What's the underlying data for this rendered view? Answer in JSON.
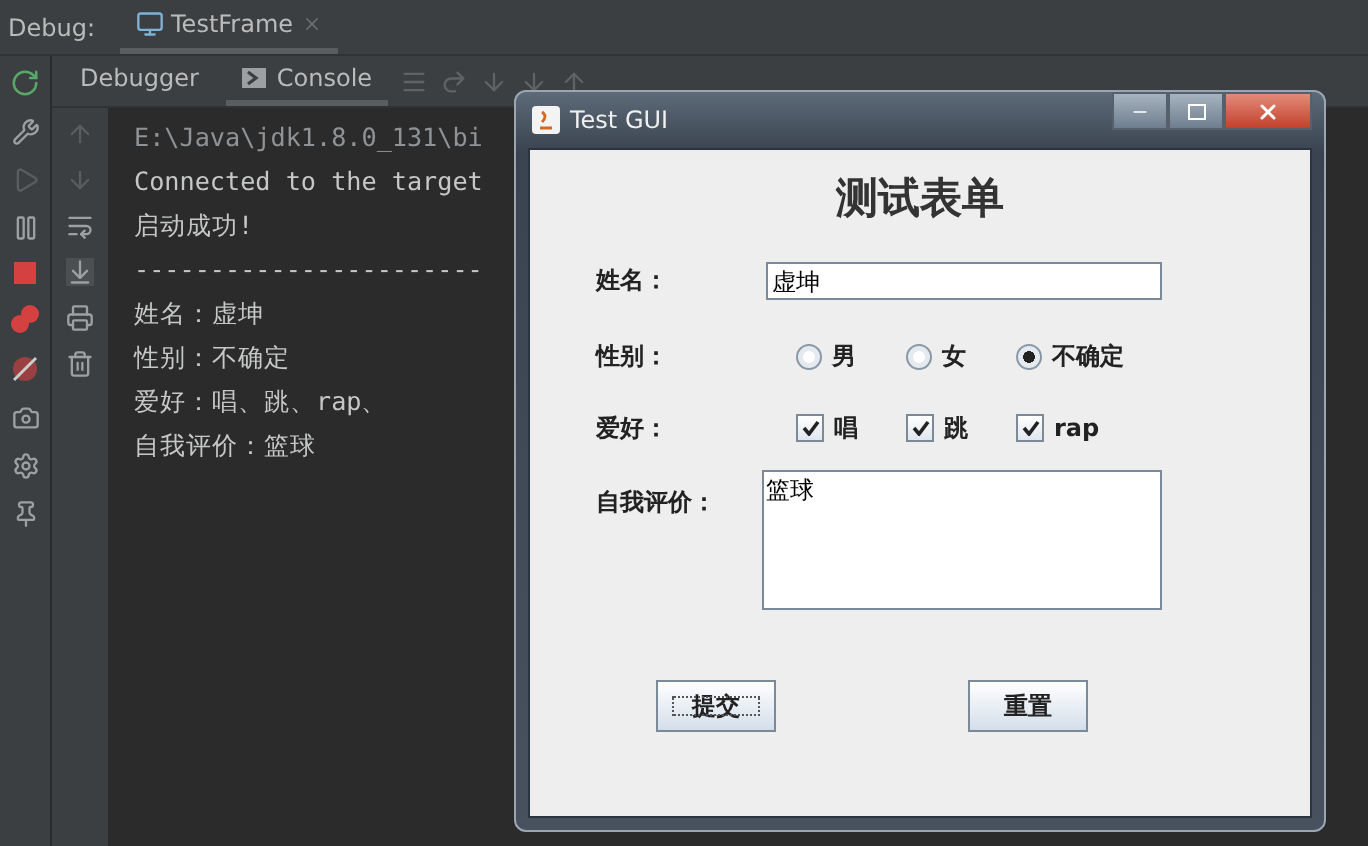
{
  "ide": {
    "debug_label": "Debug:",
    "session_tab": {
      "label": "TestFrame",
      "selected": true
    },
    "tabs": [
      {
        "label": "Debugger",
        "selected": false
      },
      {
        "label": "Console",
        "selected": true
      }
    ],
    "console_lines": [
      {
        "kind": "command",
        "text": "E:\\Java\\jdk1.8.0_131\\bi"
      },
      {
        "kind": "output",
        "text": "Connected to the target"
      },
      {
        "kind": "output",
        "text": "启动成功!"
      },
      {
        "kind": "output",
        "text": "-----------------------"
      },
      {
        "kind": "output",
        "text": "姓名：虚坤"
      },
      {
        "kind": "output",
        "text": "性别：不确定"
      },
      {
        "kind": "output",
        "text": "爱好：唱、跳、rap、"
      },
      {
        "kind": "output",
        "text": "自我评价：篮球"
      }
    ]
  },
  "dialog": {
    "title": "Test GUI",
    "heading": "测试表单",
    "name": {
      "label": "姓名：",
      "value": "虚坤"
    },
    "gender": {
      "label": "性别：",
      "options": [
        {
          "label": "男",
          "selected": false
        },
        {
          "label": "女",
          "selected": false
        },
        {
          "label": "不确定",
          "selected": true
        }
      ]
    },
    "hobbies": {
      "label": "爱好：",
      "options": [
        {
          "label": "唱",
          "checked": true
        },
        {
          "label": "跳",
          "checked": true
        },
        {
          "label": "rap",
          "checked": true
        }
      ]
    },
    "self_eval": {
      "label": "自我评价：",
      "value": "篮球"
    },
    "buttons": [
      {
        "label": "提交",
        "focused": true
      },
      {
        "label": "重置",
        "focused": false
      }
    ]
  }
}
